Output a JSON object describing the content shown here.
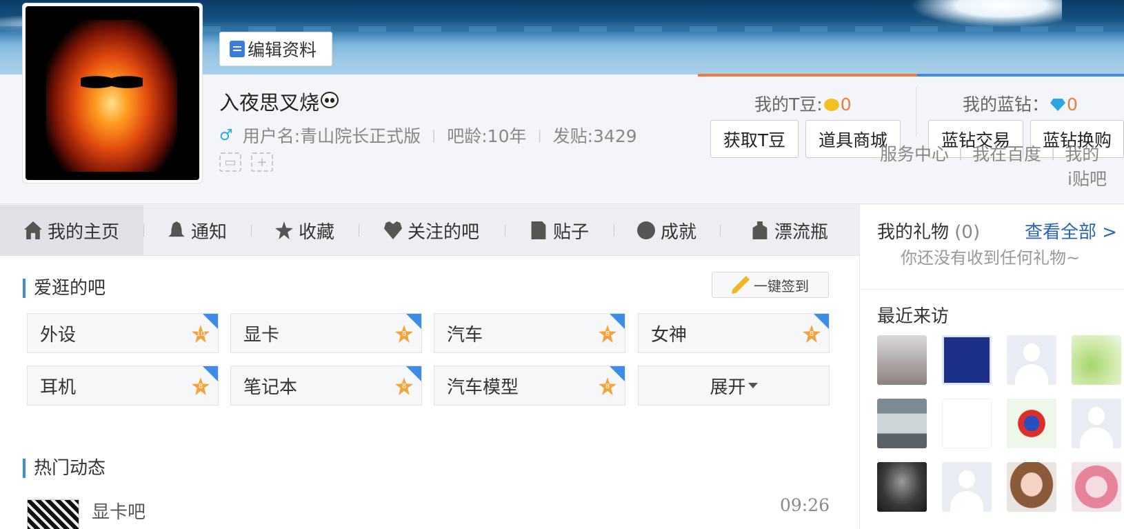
{
  "profile": {
    "edit_label": "编辑资料",
    "display_name": "入夜思叉烧",
    "username_label": "用户名:青山院长正式版",
    "bar_age": "吧龄:10年",
    "posts": "发贴:3429",
    "gender_symbol": "♂"
  },
  "wallet": {
    "tdou_label": "我的T豆:",
    "tdou_value": "0",
    "lanzuan_label": "我的蓝钻：",
    "lanzuan_value": "0",
    "get_tdou": "获取T豆",
    "shop": "道具商城",
    "lanzuan_trade": "蓝钻交易",
    "lanzuan_exchange": "蓝钻换购",
    "accent_orange": "#f07a3c",
    "accent_blue": "#3d8ce8"
  },
  "links": {
    "service_center": "服务中心",
    "my_baidu": "我在百度",
    "my": "我的",
    "itieba": "i贴吧"
  },
  "nav": {
    "home": "我的主页",
    "notify": "通知",
    "favorites": "收藏",
    "followed_bars": "关注的吧",
    "posts": "贴子",
    "achievements": "成就",
    "bottle": "漂流瓶"
  },
  "fav_bars": {
    "title": "爱逛的吧",
    "checkin": "一键签到",
    "items": [
      {
        "name": "外设",
        "level": "10"
      },
      {
        "name": "显卡",
        "level": "8"
      },
      {
        "name": "汽车",
        "level": "8"
      },
      {
        "name": "女神",
        "level": "8"
      },
      {
        "name": "耳机",
        "level": "8"
      },
      {
        "name": "笔记本",
        "level": "8"
      },
      {
        "name": "汽车模型",
        "level": "8"
      }
    ],
    "expand": "展开"
  },
  "feed": {
    "title": "热门动态",
    "item": {
      "bar": "显卡吧",
      "time": "09:26"
    }
  },
  "sidebar": {
    "gifts_title": "我的礼物",
    "gifts_count": "(0)",
    "view_all": "查看全部 >",
    "no_gift": "你还没有收到任何礼物~",
    "visitors_title": "最近来访"
  }
}
